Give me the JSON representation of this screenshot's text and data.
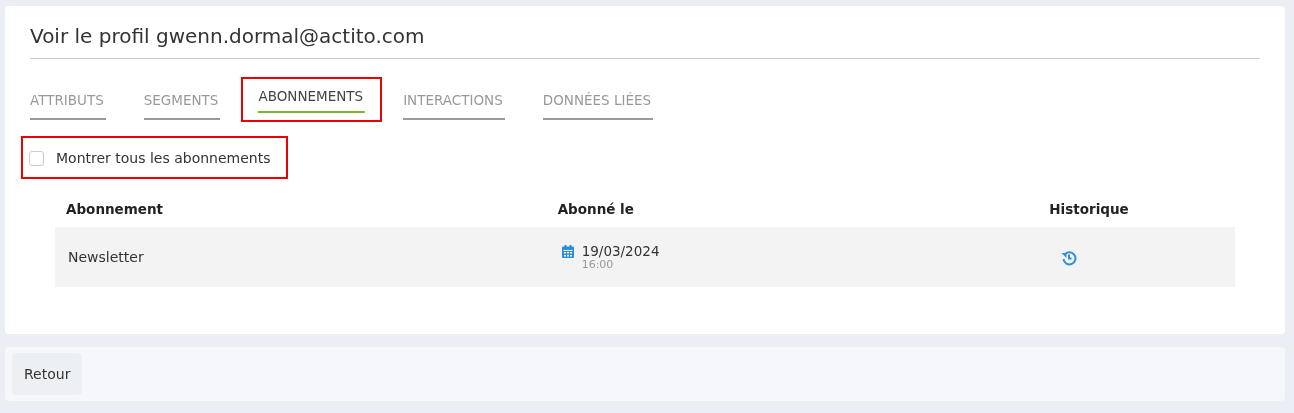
{
  "title": "Voir le profil gwenn.dormal@actito.com",
  "tabs": [
    {
      "label": "ATTRIBUTS",
      "selected": false,
      "highlighted": false
    },
    {
      "label": "SEGMENTS",
      "selected": false,
      "highlighted": false
    },
    {
      "label": "ABONNEMENTS",
      "selected": true,
      "highlighted": true
    },
    {
      "label": "INTERACTIONS",
      "selected": false,
      "highlighted": false
    },
    {
      "label": "DONNÉES LIÉES",
      "selected": false,
      "highlighted": false
    }
  ],
  "show_all": {
    "label": "Montrer tous les abonnements",
    "checked": false,
    "highlighted": true
  },
  "table": {
    "columns": [
      "Abonnement",
      "Abonné le",
      "Historique"
    ],
    "rows": [
      {
        "name": "Newsletter",
        "date": "19/03/2024",
        "time": "16:00"
      }
    ]
  },
  "footer": {
    "buttons": [
      "Retour"
    ]
  }
}
